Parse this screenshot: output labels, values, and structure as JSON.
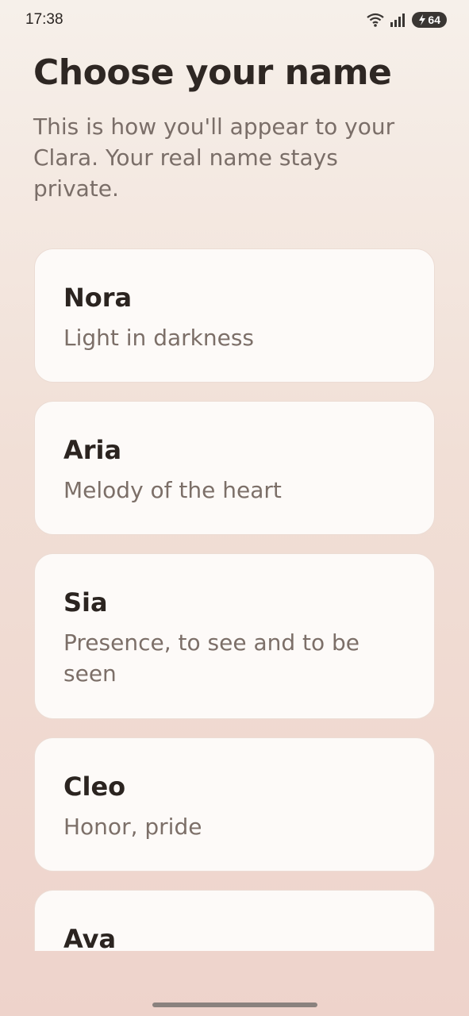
{
  "status_bar": {
    "time": "17:38",
    "battery": "64",
    "icons": [
      "wifi-icon",
      "signal-icon",
      "charging-bolt-icon"
    ]
  },
  "header": {
    "title": "Choose your name",
    "subtitle": "This is how you'll appear to your Clara. Your real name stays private."
  },
  "names": [
    {
      "name": "Nora",
      "meaning": "Light in darkness"
    },
    {
      "name": "Aria",
      "meaning": "Melody of the heart"
    },
    {
      "name": "Sia",
      "meaning": "Presence, to see and to be seen"
    },
    {
      "name": "Cleo",
      "meaning": "Honor, pride"
    },
    {
      "name": "Ava",
      "meaning": ""
    }
  ],
  "colors": {
    "card_background": "#fdfaf8",
    "title_text": "#2e2723",
    "secondary_text": "#7a6e68"
  }
}
